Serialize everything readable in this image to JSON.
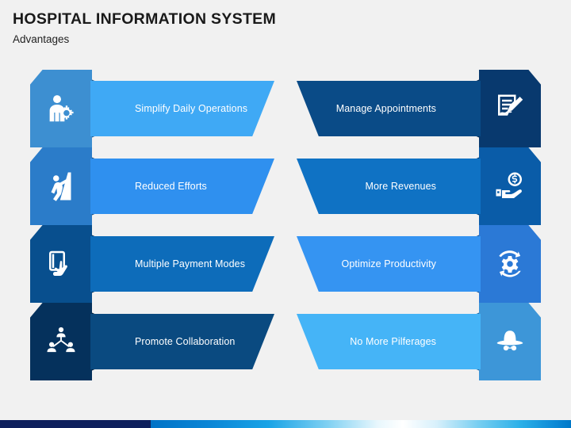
{
  "header": {
    "title": "HOSPITAL INFORMATION SYSTEM",
    "subtitle": "Advantages"
  },
  "palette": {
    "background": "#f1f1f1",
    "title_color": "#1a1a1a",
    "label_color": "#ffffff",
    "footer_navy": "#0d1f5c",
    "footer_gradient_start": "#0072c6",
    "footer_gradient_mid": "#ffffff",
    "footer_gradient_end": "#0078c8"
  },
  "rows": [
    {
      "left": {
        "label": "Simplify Daily Operations",
        "icon": "person-gear-icon",
        "plate_color": "#3d8fd1",
        "banner_color": "#3fa9f5",
        "fold_color": "#1d5f94"
      },
      "right": {
        "label": "Manage Appointments",
        "icon": "document-pencil-icon",
        "plate_color": "#08396e",
        "banner_color": "#0a4b87",
        "fold_color": "#04294f"
      }
    },
    {
      "left": {
        "label": "Reduced Efforts",
        "icon": "person-climbing-icon",
        "plate_color": "#2b7cc9",
        "banner_color": "#2f90ef",
        "fold_color": "#1a4f85"
      },
      "right": {
        "label": "More Revenues",
        "icon": "hand-dollar-icon",
        "plate_color": "#0a5ca8",
        "banner_color": "#0f72c4",
        "fold_color": "#053b71"
      }
    },
    {
      "left": {
        "label": "Multiple Payment Modes",
        "icon": "card-hand-icon",
        "plate_color": "#084f8e",
        "banner_color": "#0d6cba",
        "fold_color": "#04335f"
      },
      "right": {
        "label": "Optimize Productivity",
        "icon": "gear-refresh-icon",
        "plate_color": "#2b79d6",
        "banner_color": "#3594f2",
        "fold_color": "#164f92"
      }
    },
    {
      "left": {
        "label": "Promote Collaboration",
        "icon": "team-network-icon",
        "plate_color": "#05315c",
        "banner_color": "#0a4a80",
        "fold_color": "#021f3c"
      },
      "right": {
        "label": "No More Pilferages",
        "icon": "incognito-hat-icon",
        "plate_color": "#3d96d8",
        "banner_color": "#45b4f7",
        "fold_color": "#1e6aa8"
      }
    }
  ]
}
